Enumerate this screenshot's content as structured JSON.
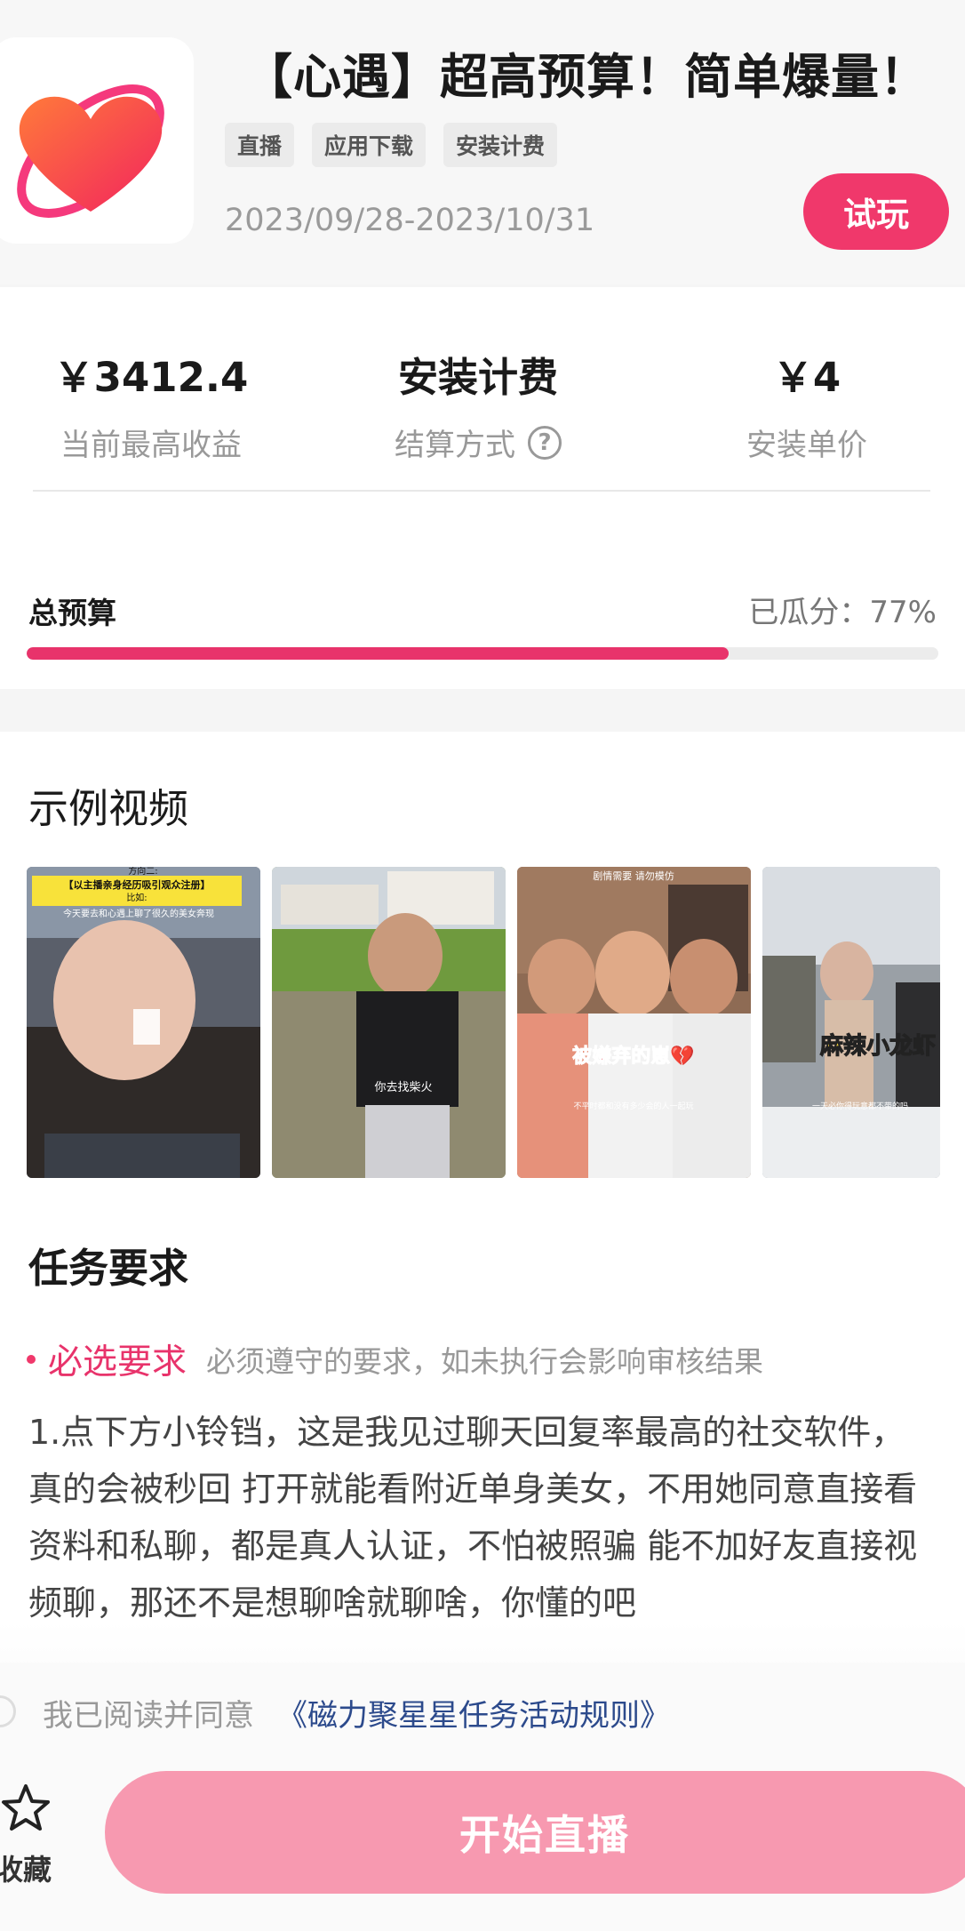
{
  "task": {
    "title": "【心遇】超高预算！简单爆量！",
    "tags": [
      "直播",
      "应用下载",
      "安装计费"
    ],
    "date_range": "2023/09/28-2023/10/31",
    "try_label": "试玩",
    "icon": "heart-logo-icon",
    "accent_color": "#f0386b"
  },
  "stats": {
    "max_income_value": "￥3412.4",
    "max_income_label": "当前最高收益",
    "settlement_value": "安装计费",
    "settlement_label": "结算方式",
    "help_glyph": "?",
    "unit_price_value": "￥4",
    "unit_price_label": "安装单价"
  },
  "budget": {
    "label": "总预算",
    "split_text": "已瓜分：77%",
    "progress": 0.77
  },
  "sample_videos": {
    "title": "示例视频",
    "items": [
      {
        "caption_top": "方向二:",
        "caption_banner": "【以主播亲身经历吸引观众注册】",
        "caption_sub": "比如:",
        "caption_line": "今天要去和心遇上聊了很久的美女奔现"
      },
      {
        "caption": "你去找柴火"
      },
      {
        "caption_top": "剧情需要 请勿模仿",
        "caption_main": "被嫌弃的崽💔",
        "caption_line": "不平时都和没有多少会的人一起玩"
      },
      {
        "caption_main": "麻辣小龙虾",
        "caption_line": "一天必你得玩意都不带的吗"
      }
    ]
  },
  "requirements": {
    "title": "任务要求",
    "required_name": "必选要求",
    "required_desc": "必须遵守的要求，如未执行会影响审核结果",
    "body": "1.点下方小铃铛，这是我见过聊天回复率最高的社交软件，真的会被秒回 打开就能看附近单身美女，不用她同意直接看资料和私聊，都是真人认证，不怕被照骗 能不加好友直接视频聊，那还不是想聊啥就聊啥，你懂的吧"
  },
  "bottom": {
    "agree_text": "我已阅读并同意",
    "agree_link": "《磁力聚星星任务活动规则》",
    "favorite_label": "收藏",
    "favorite_icon": "star-outline-icon",
    "start_label": "开始直播"
  }
}
